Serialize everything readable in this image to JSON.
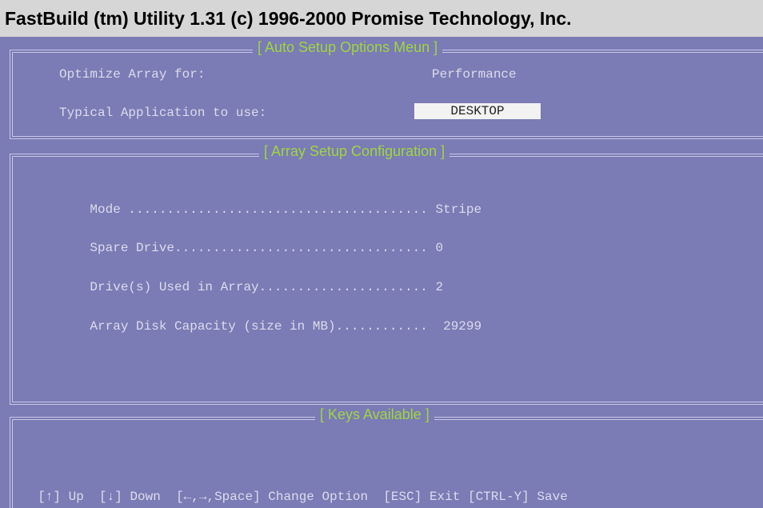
{
  "title_bar": {
    "text": "FastBuild (tm) Utility 1.31 (c) 1996-2000 Promise Technology, Inc."
  },
  "auto_setup": {
    "title": "[ Auto Setup Options Meun ]",
    "optimize_label": "Optimize Array for:",
    "optimize_value": "Performance",
    "application_label": "Typical Application to use:",
    "application_value": "DESKTOP"
  },
  "array_setup": {
    "title": "[ Array Setup Configuration ]",
    "rows": [
      {
        "label": "Mode .......................................",
        "value": "Stripe"
      },
      {
        "label": "Spare Drive.................................",
        "value": "0"
      },
      {
        "label": "Drive(s) Used in Array......................",
        "value": "2"
      },
      {
        "label": "Array Disk Capacity (size in MB)............",
        "value": " 29299"
      }
    ]
  },
  "keys": {
    "title": "[ Keys Available ]",
    "items": [
      {
        "key": "[↑]",
        "action": "Up"
      },
      {
        "key": "[↓]",
        "action": "Down"
      },
      {
        "key": "[←,→,Space]",
        "action": "Change Option"
      },
      {
        "key": "[ESC]",
        "action": "Exit"
      },
      {
        "key": "[CTRL-Y]",
        "action": "Save"
      }
    ]
  }
}
